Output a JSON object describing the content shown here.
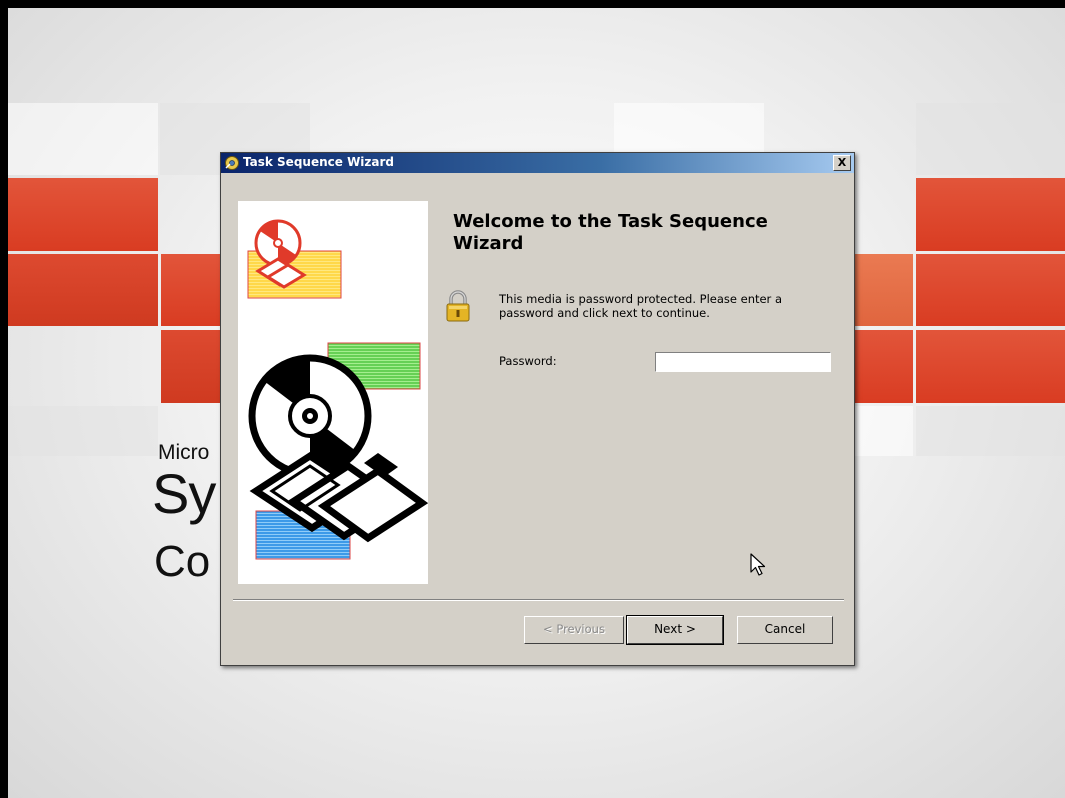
{
  "background": {
    "brand_line1": "Micro",
    "brand_line2": "Sy",
    "brand_line3": "Co"
  },
  "dialog": {
    "title": "Task Sequence Wizard",
    "close_label": "X",
    "title_icon": "wizard-gear-icon",
    "heading": "Welcome to the Task Sequence Wizard",
    "lock_icon": "padlock-icon",
    "message": "This media is password protected.  Please enter a password and click next to continue.",
    "password_label": "Password:",
    "password_value": "",
    "buttons": {
      "previous": "< Previous",
      "next": "Next >",
      "cancel": "Cancel"
    }
  },
  "colors": {
    "accent_red": "#d93c22",
    "accent_orange": "#e0653e",
    "dialog_face": "#d4d0c8",
    "titlebar_start": "#0a246a",
    "titlebar_end": "#a6caf0"
  }
}
